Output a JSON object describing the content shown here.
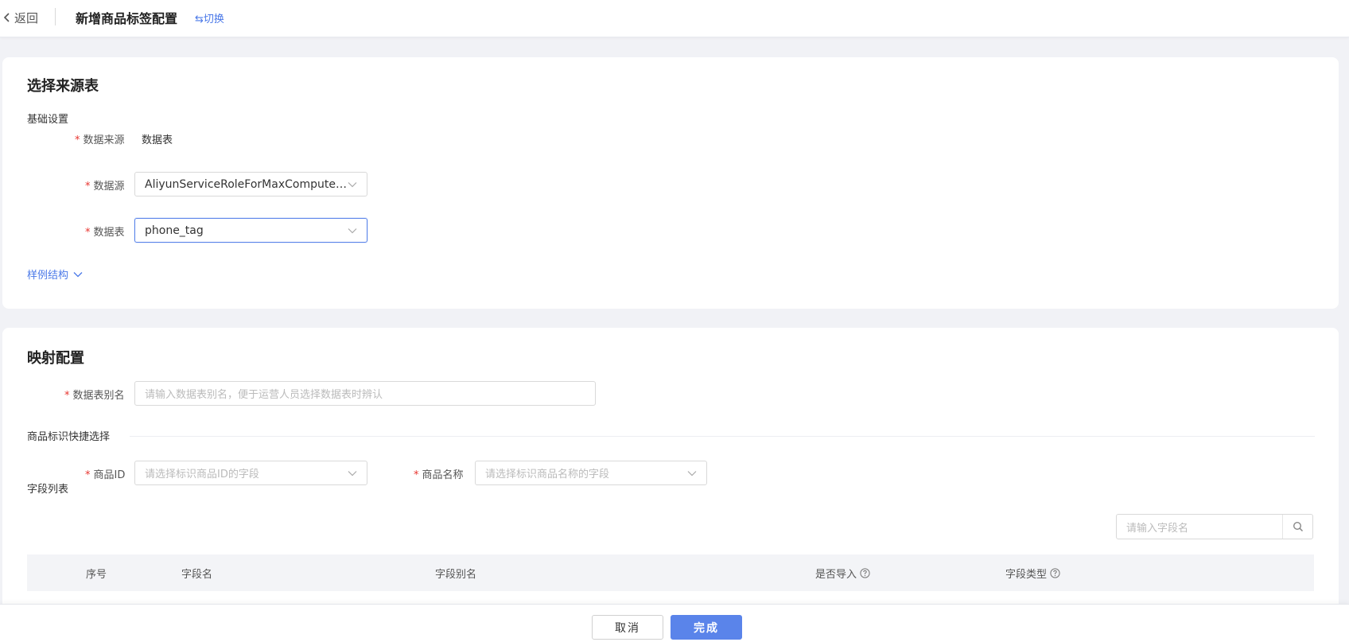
{
  "header": {
    "back_label": "返回",
    "title": "新增商品标签配置",
    "switch_label": "⇆切换"
  },
  "source_section": {
    "title": "选择来源表",
    "basic_settings": "基础设置",
    "data_origin_label": "数据来源",
    "data_origin_value": "数据表",
    "datasource_label": "数据源",
    "datasource_value": "AliyunServiceRoleForMaxComputeId...",
    "table_label": "数据表",
    "table_value": "phone_tag",
    "sample_structure_link": "样例结构"
  },
  "mapping_section": {
    "title": "映射配置",
    "alias_label": "数据表别名",
    "alias_placeholder": "请输入数据表别名，便于运营人员选择数据表时辨认",
    "quick_select_title": "商品标识快捷选择",
    "product_id_label": "商品ID",
    "product_id_placeholder": "请选择标识商品ID的字段",
    "product_name_label": "商品名称",
    "product_name_placeholder": "请选择标识商品名称的字段",
    "field_list_title": "字段列表",
    "field_search_placeholder": "请输入字段名",
    "table_columns": {
      "index": "序号",
      "field_name": "字段名",
      "field_alias": "字段别名",
      "import": "是否导入",
      "field_type": "字段类型"
    }
  },
  "footer": {
    "cancel_label": "取消",
    "confirm_label": "完成"
  },
  "colors": {
    "primary": "#5a84ea",
    "link": "#4a78e8",
    "required": "#e8342f"
  }
}
